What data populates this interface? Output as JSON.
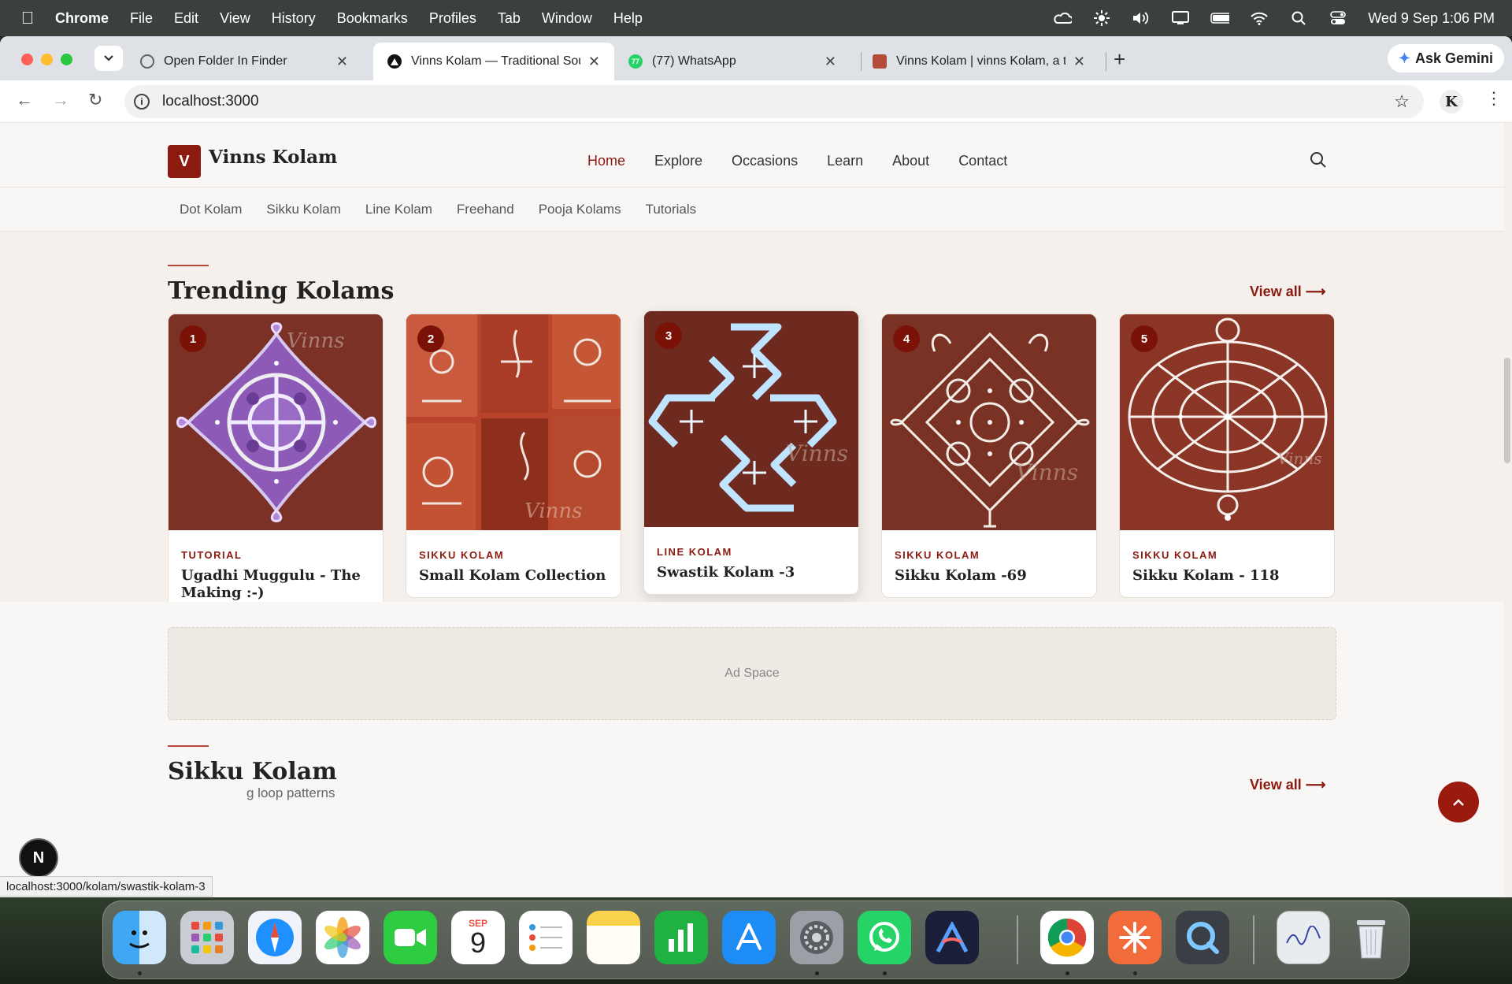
{
  "menubar": {
    "app": "Chrome",
    "items": [
      "File",
      "Edit",
      "View",
      "History",
      "Bookmarks",
      "Profiles",
      "Tab",
      "Window",
      "Help"
    ],
    "clock": "Wed 9 Sep  1:06 PM"
  },
  "browser": {
    "tabs": [
      {
        "title": "Open Folder In Finder",
        "favicon_color": "#5f6368"
      },
      {
        "title": "Vinns Kolam — Traditional Sou",
        "favicon_color": "#111111"
      },
      {
        "title": "(77) WhatsApp",
        "favicon_color": "#25d366",
        "badge": "77"
      },
      {
        "title": "Vinns Kolam | vinns Kolam, a t",
        "favicon_color": "#b34a3a"
      }
    ],
    "ask_gemini": "Ask Gemini",
    "url": "localhost:3000",
    "profile_letter": "K",
    "status_url": "localhost:3000/kolam/swastik-kolam-3"
  },
  "site": {
    "logo_letter": "V",
    "brand": "Vinns Kolam",
    "nav": [
      "Home",
      "Explore",
      "Occasions",
      "Learn",
      "About",
      "Contact"
    ],
    "subnav": [
      "Dot Kolam",
      "Sikku Kolam",
      "Line Kolam",
      "Freehand",
      "Pooja Kolams",
      "Tutorials"
    ],
    "accent": "#8b1a10"
  },
  "trending": {
    "title": "Trending Kolams",
    "view_all": "View all",
    "cards": [
      {
        "rank": "1",
        "category": "TUTORIAL",
        "title": "Ugadhi Muggulu - The Making :-)",
        "watermark": "Vinns"
      },
      {
        "rank": "2",
        "category": "SIKKU KOLAM",
        "title": "Small Kolam Collection",
        "watermark": "Vinns"
      },
      {
        "rank": "3",
        "category": "LINE KOLAM",
        "title": "Swastik Kolam -3",
        "watermark": "Vinns"
      },
      {
        "rank": "4",
        "category": "SIKKU KOLAM",
        "title": "Sikku Kolam -69",
        "watermark": "Vinns"
      },
      {
        "rank": "5",
        "category": "SIKKU KOLAM",
        "title": "Sikku Kolam - 118",
        "watermark": "Vinns"
      }
    ]
  },
  "ad": {
    "label": "Ad Space"
  },
  "sikku": {
    "title": "Sikku Kolam",
    "subtitle": "g loop patterns",
    "view_all": "View all"
  },
  "dock": {
    "calendar_month": "SEP",
    "calendar_day": "9"
  }
}
